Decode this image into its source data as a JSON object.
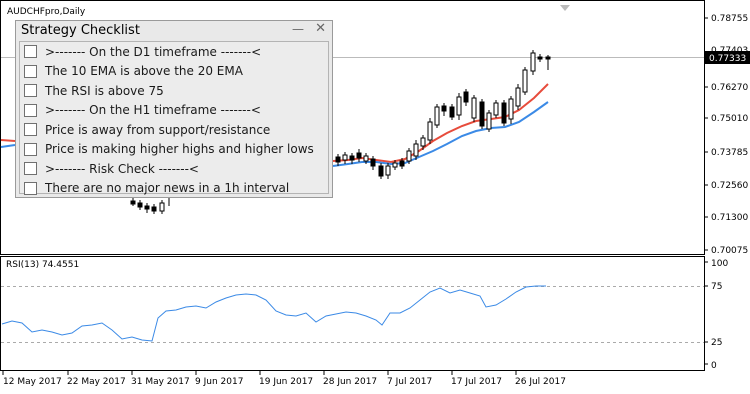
{
  "chart": {
    "symbol_title": "AUDCHFpro,Daily",
    "price_labels": [
      "0.78755",
      "0.77333",
      "0.76270",
      "0.75010",
      "0.73785",
      "0.72560",
      "0.71300",
      "0.70075"
    ],
    "current_price": "0.77333",
    "current_price_partial": "0.77403"
  },
  "rsi": {
    "label": "RSI(13) 74.4551",
    "levels": [
      "100",
      "75",
      "25",
      "0"
    ]
  },
  "time_axis": [
    "12 May 2017",
    "22 May 2017",
    "31 May 2017",
    "9 Jun 2017",
    "19 Jun 2017",
    "28 Jun 2017",
    "7 Jul 2017",
    "17 Jul 2017",
    "26 Jul 2017"
  ],
  "checklist": {
    "title": "Strategy Checklist",
    "minimize_glyph": "—",
    "close_glyph": "✕",
    "items": [
      ">------- On the D1 timeframe -------<",
      "The 10 EMA is above the 20 EMA",
      "The RSI is above 75",
      ">------- On the H1 timeframe -------<",
      "Price is away from support/resistance",
      "Price is making higher highs and higher lows",
      ">------- Risk Check -------<",
      "There are no major news in a 1h interval"
    ]
  },
  "colors": {
    "ema_fast": "#e74c3c",
    "ema_slow": "#3b8ae6",
    "rsi_line": "#3b8ae6",
    "panel_bg": "#e9e9e9"
  }
}
